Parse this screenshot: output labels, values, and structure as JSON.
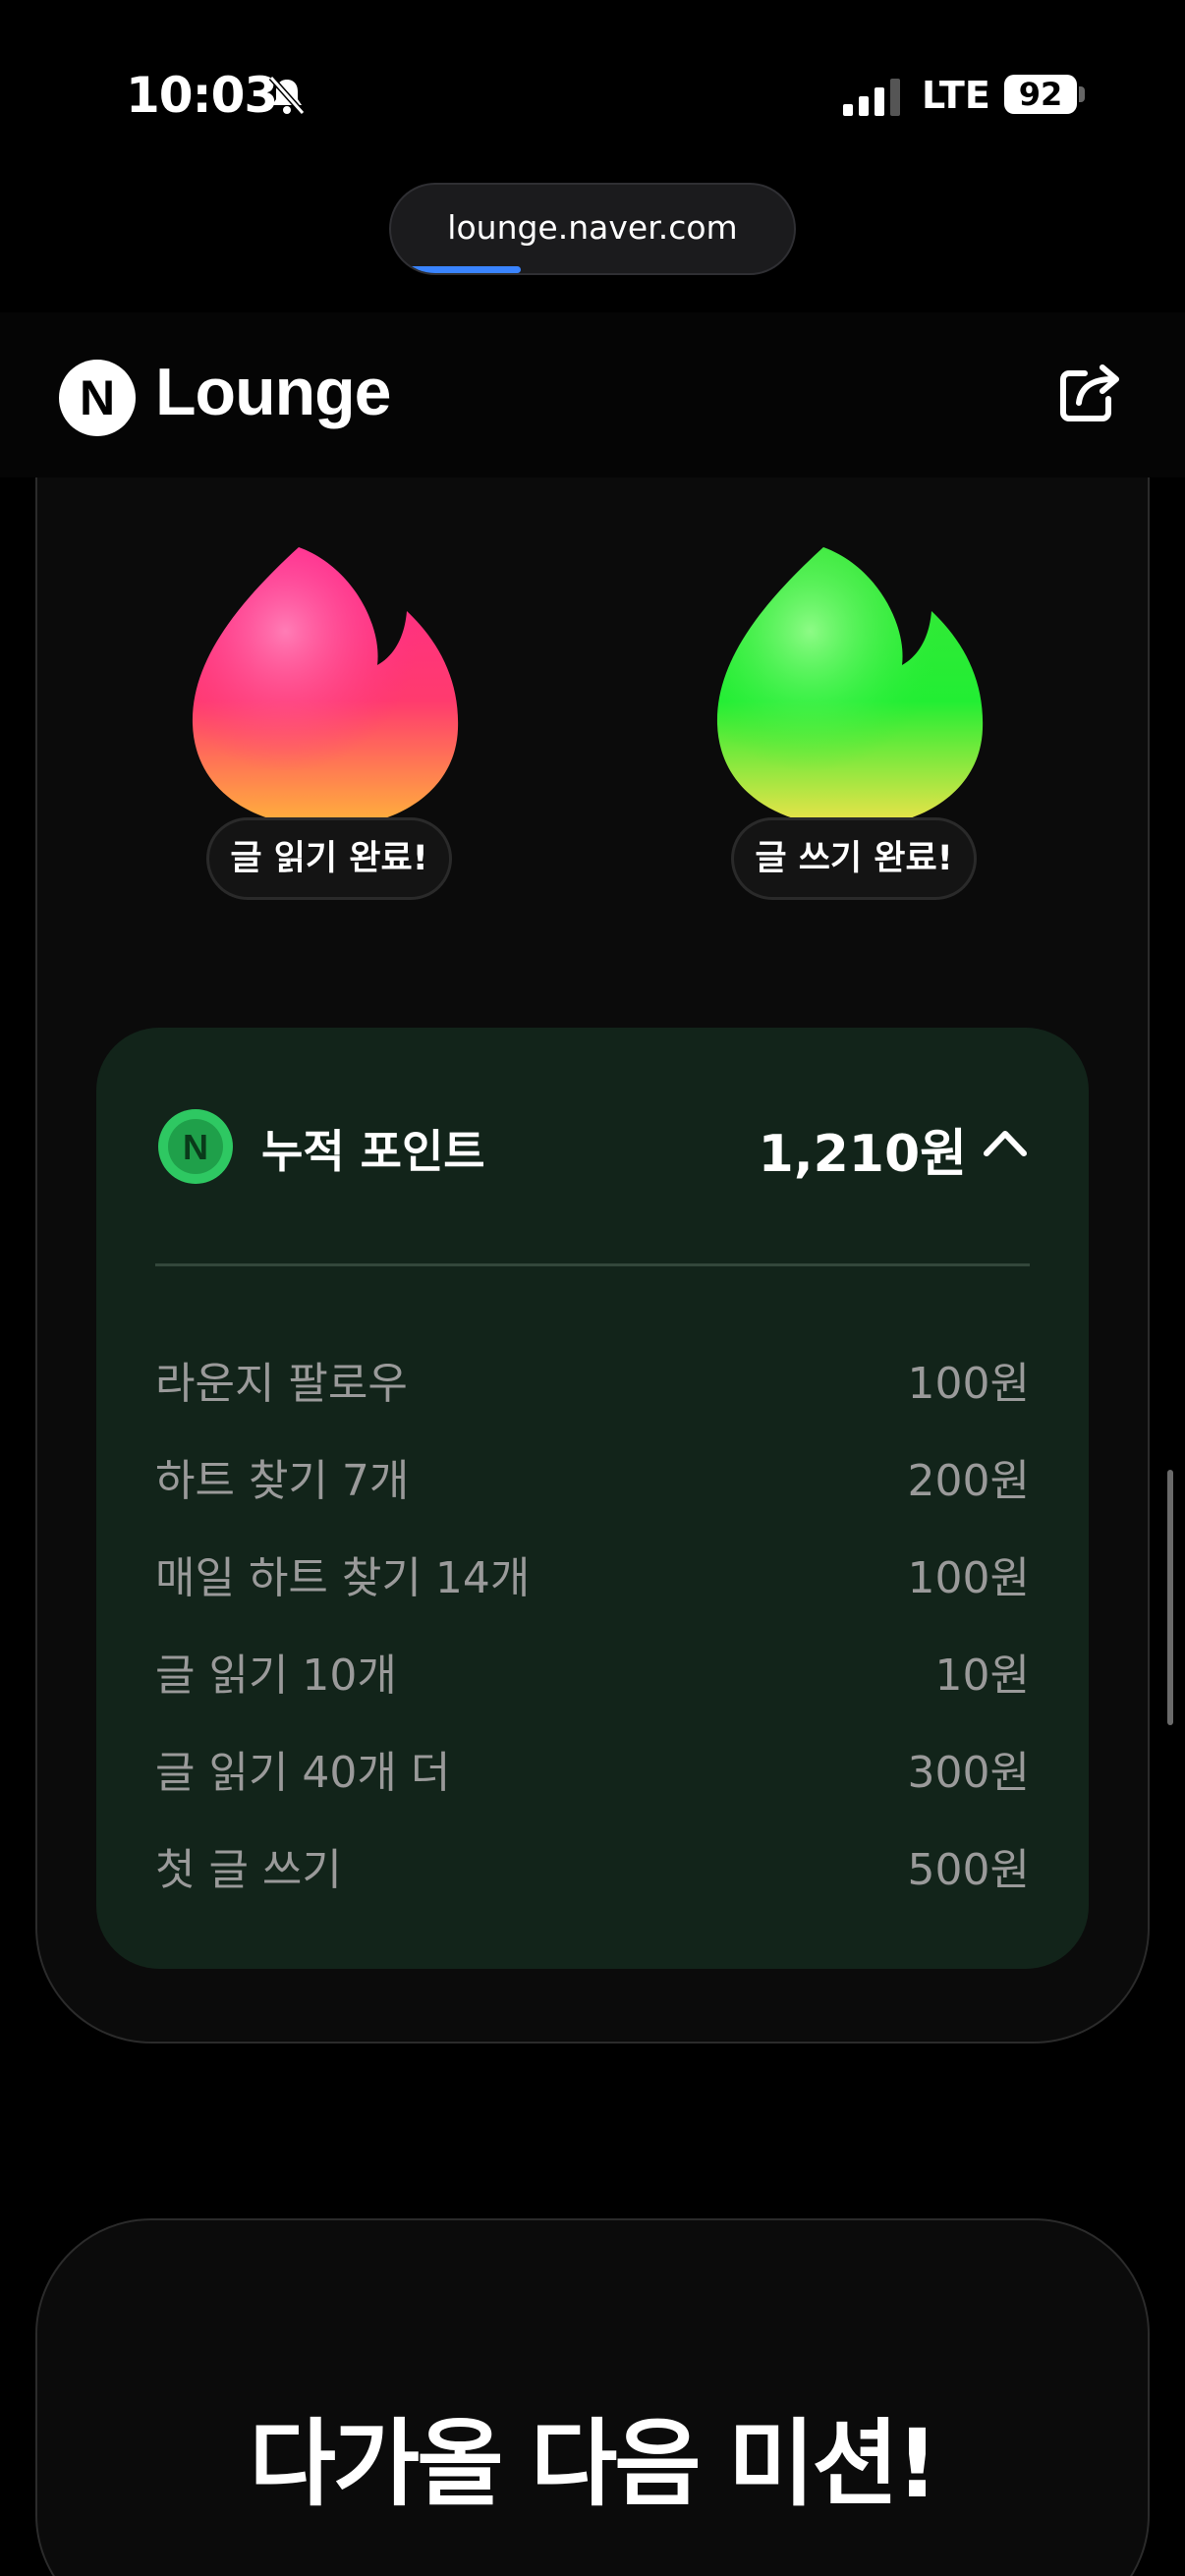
{
  "status_bar": {
    "time": "10:03",
    "network": "LTE",
    "battery": "92"
  },
  "browser": {
    "url": "lounge.naver.com"
  },
  "header": {
    "logo_letter": "N",
    "title": "Lounge"
  },
  "missions": {
    "read_badge": "글 읽기 완료!",
    "write_badge": "글 쓰기 완료!"
  },
  "points": {
    "title": "누적 포인트",
    "total": "1,210원",
    "items": [
      {
        "label": "라운지 팔로우",
        "value": "100원"
      },
      {
        "label": "하트 찾기 7개",
        "value": "200원"
      },
      {
        "label": "매일 하트 찾기 14개",
        "value": "100원"
      },
      {
        "label": "글 읽기 10개",
        "value": "10원"
      },
      {
        "label": "글 읽기 40개 더",
        "value": "300원"
      },
      {
        "label": "첫 글 쓰기",
        "value": "500원"
      }
    ]
  },
  "next_mission": {
    "title": "다가올 다음 미션!"
  },
  "colors": {
    "accent_blue": "#3a84ff",
    "points_bg": "#12241a",
    "coin_green": "#2ec862"
  }
}
